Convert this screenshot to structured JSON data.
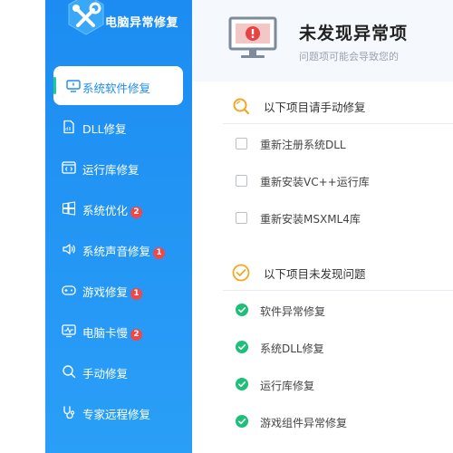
{
  "app": {
    "title": "电脑异常修复"
  },
  "sidebar": {
    "items": [
      {
        "label": "系统软件修复",
        "badge": "",
        "active": true
      },
      {
        "label": "DLL修复",
        "badge": ""
      },
      {
        "label": "运行库修复",
        "badge": ""
      },
      {
        "label": "系统优化",
        "badge": "2"
      },
      {
        "label": "系统声音修复",
        "badge": "1"
      },
      {
        "label": "游戏修复",
        "badge": "1"
      },
      {
        "label": "电脑卡慢",
        "badge": "2"
      },
      {
        "label": "手动修复",
        "badge": ""
      },
      {
        "label": "专家远程修复",
        "badge": ""
      }
    ]
  },
  "header": {
    "title": "未发现异常项",
    "subtitle": "问题项可能会导致您的"
  },
  "manual_section": {
    "title": "以下项目请手动修复",
    "items": [
      "重新注册系统DLL",
      "重新安装VC++运行库",
      "重新安装MSXML4库"
    ]
  },
  "ok_section": {
    "title": "以下项目未发现问题",
    "items": [
      "软件异常修复",
      "系统DLL修复",
      "运行库修复",
      "游戏组件异常修复"
    ]
  },
  "colors": {
    "sidebar_blue": "#1c8cf2",
    "active_indicator": "#1fcc8c",
    "badge_red": "#f04848",
    "check_green": "#1fbf7a",
    "warn_orange": "#f5a623"
  }
}
